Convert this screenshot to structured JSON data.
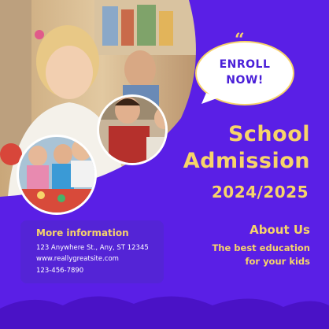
{
  "enroll": {
    "line1": "ENROLL",
    "line2": "NOW!",
    "quote_glyph": "“"
  },
  "title": {
    "line1": "School",
    "line2": "Admission"
  },
  "year": "2024/2025",
  "about": {
    "title": "About Us",
    "line1": "The best education",
    "line2": "for your kids"
  },
  "info": {
    "title": "More information",
    "address": "123 Anywhere St., Any, ST 12345",
    "website": "www.reallygreatsite.com",
    "phone": "123-456-7890"
  },
  "colors": {
    "background": "#5a1fe6",
    "accent": "#f7d46a",
    "bubble": "#ffffff",
    "bubble_text": "#4a1fd8"
  },
  "images": {
    "hero": "girl-with-pencil-photo",
    "circle_1": "boy-writing-photo",
    "circle_2": "children-playing-photo"
  }
}
